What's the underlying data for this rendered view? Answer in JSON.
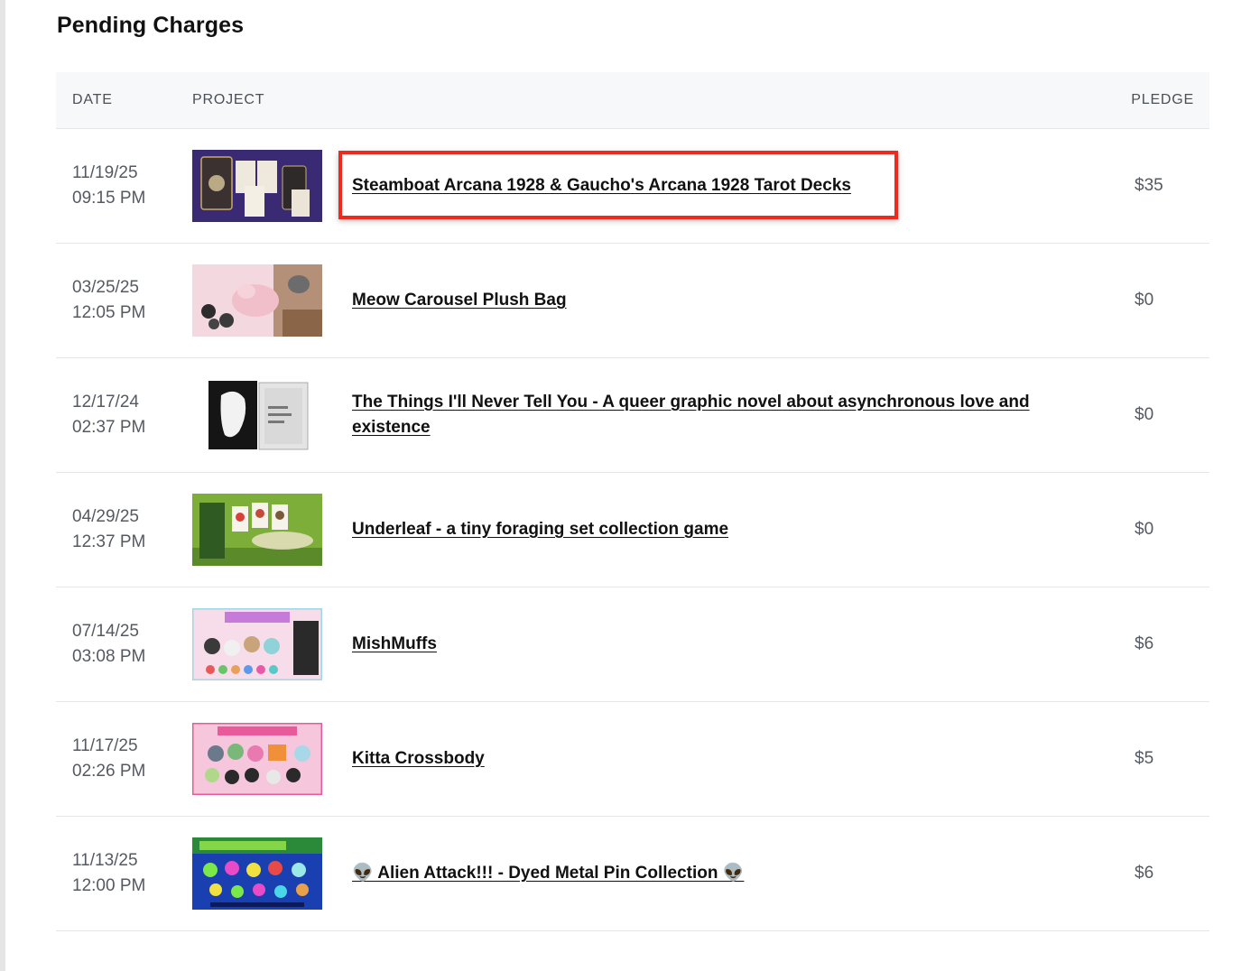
{
  "page": {
    "title": "Pending Charges"
  },
  "table": {
    "headers": {
      "date": "DATE",
      "project": "PROJECT",
      "pledge": "PLEDGE"
    },
    "rows": [
      {
        "date": "11/19/25",
        "time": "09:15 PM",
        "project": "Steamboat Arcana 1928 & Gaucho's Arcana 1928 Tarot Decks",
        "pledge": "$35",
        "thumb_icon": "tarot-deck-thumbnail"
      },
      {
        "date": "03/25/25",
        "time": "12:05 PM",
        "project": "Meow Carousel Plush Bag",
        "pledge": "$0",
        "thumb_icon": "plush-bag-thumbnail"
      },
      {
        "date": "12/17/24",
        "time": "02:37 PM",
        "project": "The Things I'll Never Tell You - A queer graphic novel about asynchronous love and existence",
        "pledge": "$0",
        "thumb_icon": "graphic-novel-thumbnail"
      },
      {
        "date": "04/29/25",
        "time": "12:37 PM",
        "project": "Underleaf - a tiny foraging set collection game",
        "pledge": "$0",
        "thumb_icon": "card-game-thumbnail"
      },
      {
        "date": "07/14/25",
        "time": "03:08 PM",
        "project": "MishMuffs",
        "pledge": "$6",
        "thumb_icon": "plush-toys-thumbnail"
      },
      {
        "date": "11/17/25",
        "time": "02:26 PM",
        "project": "Kitta Crossbody",
        "pledge": "$5",
        "thumb_icon": "crossbody-bag-thumbnail"
      },
      {
        "date": "11/13/25",
        "time": "12:00 PM",
        "project": "👽 Alien Attack!!! - Dyed Metal Pin Collection 👽",
        "pledge": "$6",
        "thumb_icon": "alien-pins-thumbnail"
      }
    ]
  },
  "annotation": {
    "highlight_color": "#ee2a1f"
  }
}
